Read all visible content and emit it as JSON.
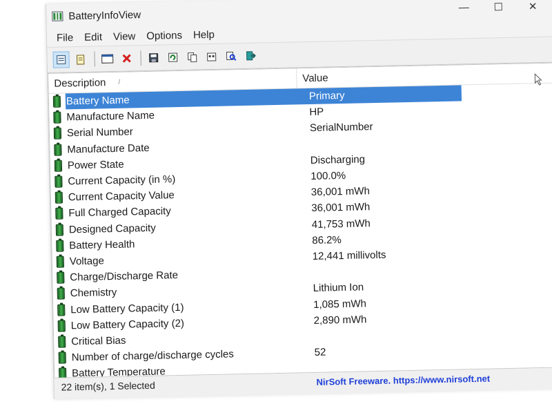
{
  "window": {
    "title": "BatteryInfoView",
    "controls": {
      "minimize": "—",
      "maximize": "☐",
      "close": "✕"
    }
  },
  "menu": [
    "File",
    "Edit",
    "View",
    "Options",
    "Help"
  ],
  "toolbar_icons": [
    "html-report-icon",
    "properties-icon",
    "window-icon",
    "delete-icon",
    "save-icon",
    "refresh-icon",
    "copy-icon",
    "settings-icon",
    "find-icon",
    "exit-icon"
  ],
  "columns": {
    "description": "Description",
    "value": "Value"
  },
  "rows": [
    {
      "description": "Battery Name",
      "value": "Primary"
    },
    {
      "description": "Manufacture Name",
      "value": "HP"
    },
    {
      "description": "Serial Number",
      "value": "SerialNumber"
    },
    {
      "description": "Manufacture Date",
      "value": ""
    },
    {
      "description": "Power State",
      "value": "Discharging"
    },
    {
      "description": "Current Capacity (in %)",
      "value": "100.0%"
    },
    {
      "description": "Current Capacity Value",
      "value": "36,001 mWh"
    },
    {
      "description": "Full Charged Capacity",
      "value": "36,001 mWh"
    },
    {
      "description": "Designed Capacity",
      "value": "41,753 mWh"
    },
    {
      "description": "Battery Health",
      "value": "86.2%"
    },
    {
      "description": "Voltage",
      "value": "12,441 millivolts"
    },
    {
      "description": "Charge/Discharge Rate",
      "value": ""
    },
    {
      "description": "Chemistry",
      "value": "Lithium Ion"
    },
    {
      "description": "Low Battery Capacity (1)",
      "value": "1,085 mWh"
    },
    {
      "description": "Low Battery Capacity (2)",
      "value": "2,890 mWh"
    },
    {
      "description": "Critical Bias",
      "value": ""
    },
    {
      "description": "Number of charge/discharge cycles",
      "value": "52"
    },
    {
      "description": "Battery Temperature",
      "value": ""
    }
  ],
  "selected_row": 0,
  "status": {
    "count": "22 item(s), 1 Selected",
    "link": "NirSoft Freeware. https://www.nirsoft.net"
  },
  "colors": {
    "selection": "#3d84d6",
    "battery": "#2f8a3c",
    "link": "#1f3fd8"
  }
}
